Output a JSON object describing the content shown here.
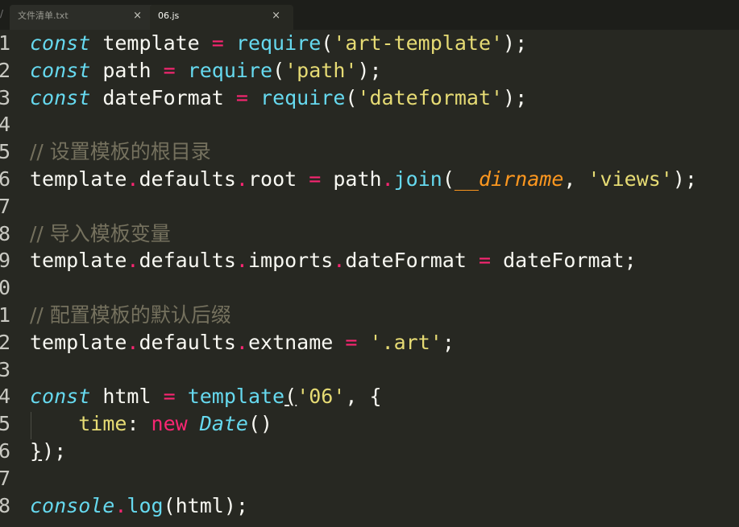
{
  "tabs": [
    {
      "label": "文件清单.txt",
      "active": false,
      "close": "×"
    },
    {
      "label": "06.js",
      "active": true,
      "close": "×"
    }
  ],
  "tab_edge_icon": "/",
  "editor": {
    "lines": [
      {
        "num": "1",
        "tokens": [
          [
            "kw",
            "const"
          ],
          [
            "punct",
            " template "
          ],
          [
            "op",
            "="
          ],
          [
            "punct",
            " "
          ],
          [
            "fn",
            "require"
          ],
          [
            "punct",
            "("
          ],
          [
            "str",
            "'art-template'"
          ],
          [
            "punct",
            ");"
          ]
        ]
      },
      {
        "num": "2",
        "tokens": [
          [
            "kw",
            "const"
          ],
          [
            "punct",
            " path "
          ],
          [
            "op",
            "="
          ],
          [
            "punct",
            " "
          ],
          [
            "fn",
            "require"
          ],
          [
            "punct",
            "("
          ],
          [
            "str",
            "'path'"
          ],
          [
            "punct",
            ");"
          ]
        ]
      },
      {
        "num": "3",
        "tokens": [
          [
            "kw",
            "const"
          ],
          [
            "punct",
            " dateFormat "
          ],
          [
            "op",
            "="
          ],
          [
            "punct",
            " "
          ],
          [
            "fn",
            "require"
          ],
          [
            "punct",
            "("
          ],
          [
            "str",
            "'dateformat'"
          ],
          [
            "punct",
            ");"
          ]
        ]
      },
      {
        "num": "4",
        "tokens": []
      },
      {
        "num": "5",
        "tokens": [
          [
            "cmt",
            "// 设置模板的根目录"
          ]
        ]
      },
      {
        "num": "6",
        "tokens": [
          [
            "punct",
            "template"
          ],
          [
            "op",
            "."
          ],
          [
            "punct",
            "defaults"
          ],
          [
            "op",
            "."
          ],
          [
            "punct",
            "root "
          ],
          [
            "op",
            "="
          ],
          [
            "punct",
            " path"
          ],
          [
            "op",
            "."
          ],
          [
            "fn",
            "join"
          ],
          [
            "punct",
            "("
          ],
          [
            "arg",
            "__dirname"
          ],
          [
            "punct",
            ", "
          ],
          [
            "str",
            "'views'"
          ],
          [
            "punct",
            ");"
          ]
        ]
      },
      {
        "num": "7",
        "tokens": []
      },
      {
        "num": "8",
        "tokens": [
          [
            "cmt",
            "// 导入模板变量"
          ]
        ]
      },
      {
        "num": "9",
        "tokens": [
          [
            "punct",
            "template"
          ],
          [
            "op",
            "."
          ],
          [
            "punct",
            "defaults"
          ],
          [
            "op",
            "."
          ],
          [
            "punct",
            "imports"
          ],
          [
            "op",
            "."
          ],
          [
            "punct",
            "dateFormat "
          ],
          [
            "op",
            "="
          ],
          [
            "punct",
            " dateFormat;"
          ]
        ]
      },
      {
        "num": "0",
        "tokens": []
      },
      {
        "num": "1",
        "tokens": [
          [
            "cmt",
            "// 配置模板的默认后缀"
          ]
        ]
      },
      {
        "num": "2",
        "tokens": [
          [
            "punct",
            "template"
          ],
          [
            "op",
            "."
          ],
          [
            "punct",
            "defaults"
          ],
          [
            "op",
            "."
          ],
          [
            "punct",
            "extname "
          ],
          [
            "op",
            "="
          ],
          [
            "punct",
            " "
          ],
          [
            "str",
            "'.art'"
          ],
          [
            "punct",
            ";"
          ]
        ]
      },
      {
        "num": "3",
        "tokens": []
      },
      {
        "num": "4",
        "tokens": [
          [
            "kw",
            "const"
          ],
          [
            "punct",
            " html "
          ],
          [
            "op",
            "="
          ],
          [
            "punct",
            " "
          ],
          [
            "fn",
            "template"
          ],
          [
            "uline",
            "("
          ],
          [
            "str",
            "'06'"
          ],
          [
            "punct",
            ", {"
          ]
        ]
      },
      {
        "num": "5",
        "tokens": [
          [
            "punct",
            "    "
          ],
          [
            "prop",
            "time"
          ],
          [
            "punct",
            ": "
          ],
          [
            "fn-new",
            "new"
          ],
          [
            "punct",
            " "
          ],
          [
            "cls",
            "Date"
          ],
          [
            "punct",
            "()"
          ]
        ]
      },
      {
        "num": "6",
        "tokens": [
          [
            "uline",
            "}"
          ],
          [
            "punct",
            ")"
          ],
          [
            "punct",
            ";"
          ]
        ]
      },
      {
        "num": "7",
        "tokens": []
      },
      {
        "num": "8",
        "tokens": [
          [
            "kw",
            "console"
          ],
          [
            "op",
            "."
          ],
          [
            "fn",
            "log"
          ],
          [
            "punct",
            "(html);"
          ]
        ]
      }
    ]
  },
  "colors": {
    "background": "#272822",
    "keyword": "#66d9ef",
    "operator": "#f92672",
    "string": "#e6db74",
    "comment": "#75715e",
    "argument": "#fd971f"
  }
}
